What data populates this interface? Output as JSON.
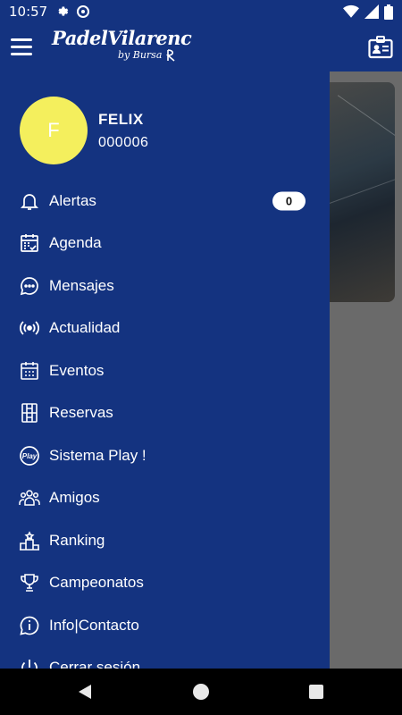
{
  "status_bar": {
    "time": "10:57",
    "icons": [
      "settings-icon",
      "data-saver-icon",
      "wifi-icon",
      "signal-icon",
      "battery-icon"
    ]
  },
  "app_bar": {
    "brand_name": "PadelVilarenc",
    "brand_sub": "by Bursa",
    "left_icon": "hamburger-menu-icon",
    "right_icon": "member-card-icon"
  },
  "drawer": {
    "user": {
      "initial": "F",
      "name": "FELIX",
      "id": "000006",
      "avatar_color": "#f4ef5d"
    },
    "items": [
      {
        "label": "Alertas",
        "icon": "bell-icon",
        "badge": "0"
      },
      {
        "label": "Agenda",
        "icon": "calendar-check-icon"
      },
      {
        "label": "Mensajes",
        "icon": "chat-bubble-icon"
      },
      {
        "label": "Actualidad",
        "icon": "broadcast-icon"
      },
      {
        "label": "Eventos",
        "icon": "calendar-grid-icon"
      },
      {
        "label": "Reservas",
        "icon": "court-icon"
      },
      {
        "label": "Sistema Play !",
        "icon": "play-badge-icon"
      },
      {
        "label": "Amigos",
        "icon": "group-icon"
      },
      {
        "label": "Ranking",
        "icon": "podium-icon"
      },
      {
        "label": "Campeonatos",
        "icon": "trophy-icon"
      },
      {
        "label": "Info|Contacto",
        "icon": "info-icon"
      },
      {
        "label": "Cerrar sesión",
        "icon": "power-icon"
      }
    ]
  },
  "colors": {
    "primary": "#143380",
    "scrim": "#6a6a6a",
    "badge_bg": "#ffffff"
  },
  "nav_bar": {
    "icons": [
      "back-icon",
      "home-icon",
      "recents-icon"
    ]
  }
}
